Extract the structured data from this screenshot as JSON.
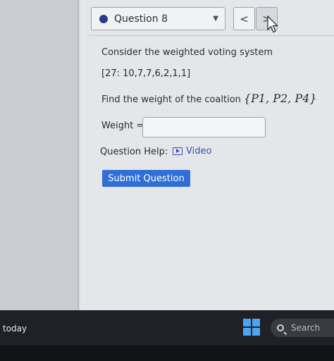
{
  "question_selector": {
    "label": "Question 8",
    "caret": "▼"
  },
  "nav": {
    "prev": "<",
    "next": ">"
  },
  "problem": {
    "intro": "Consider the weighted voting system",
    "system": "[27: 10,7,7,6,2,1,1]",
    "prompt": "Find the weight of the coaltion",
    "coalition": "{P1, P2, P4}"
  },
  "answer": {
    "label": "Weight =",
    "value": ""
  },
  "help": {
    "label": "Question Help:",
    "video": "Video"
  },
  "submit_label": "Submit Question",
  "taskbar": {
    "weather_text": "today",
    "search_placeholder": "Search"
  },
  "colors": {
    "accent": "#2f6fd6",
    "link": "#3651b5",
    "dot": "#2c3a8c"
  }
}
